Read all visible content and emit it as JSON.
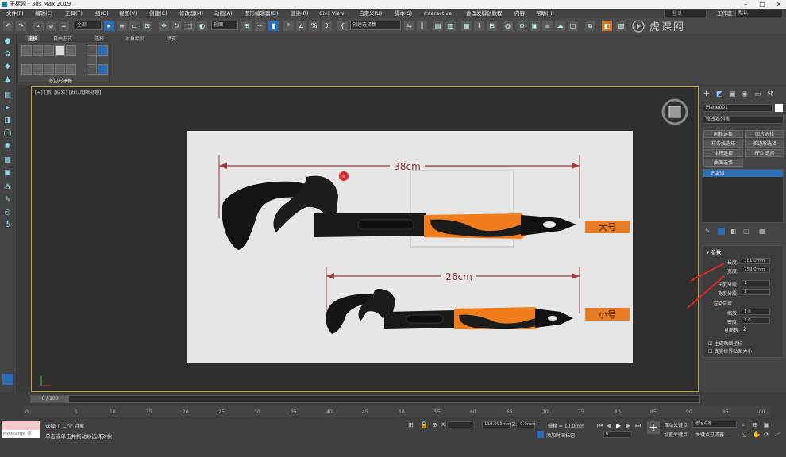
{
  "window": {
    "title": "无标题 - 3ds Max 2019"
  },
  "menu": [
    "文件(F)",
    "编辑(E)",
    "工具(T)",
    "组(G)",
    "视图(V)",
    "创建(C)",
    "修改器(M)",
    "动画(A)",
    "图形编辑器(D)",
    "渲染(R)",
    "Civil View",
    "自定义(U)",
    "脚本(S)",
    "Interactive",
    "香理发脚创教程",
    "内容",
    "帮助(H)"
  ],
  "search": {
    "placeholder": "登录"
  },
  "workspace_label": "工作区",
  "workspace_value": "默认",
  "toolbar": {
    "selection_filter": "全部",
    "ref_coord": "视图",
    "named_selection": "创建选择集"
  },
  "ribbon": {
    "tabs": [
      "建模",
      "自由形式",
      "选择",
      "对象绘制",
      "填充"
    ],
    "group_label": "多边形建模"
  },
  "viewport": {
    "label": "[+] [顶] [标准] [默认明暗处理]"
  },
  "image": {
    "large_dim": "38cm",
    "small_dim": "26cm",
    "large_tag": "大号",
    "small_tag": "小号"
  },
  "command_panel": {
    "object_name": "Plane001",
    "modifier_list": "修改器列表",
    "buttons": [
      "网格选择",
      "面片选择",
      "样条线选择",
      "多边形选择",
      "体积选择",
      "FFD 选择",
      "曲面选择"
    ],
    "stack_item": "Plane",
    "rollout_title": "参数",
    "length_label": "长度:",
    "length_value": "381.0mm",
    "width_label": "宽度:",
    "width_value": "759.0mm",
    "length_segs_label": "长度分段:",
    "length_segs_value": "1",
    "width_segs_label": "宽度分段:",
    "width_segs_value": "1",
    "render_mult_label": "渲染倍增",
    "scale_label": "缩放:",
    "scale_value": "1.0",
    "density_label": "密度:",
    "density_value": "1.0",
    "total_faces_label": "总面数:",
    "total_faces_value": "2",
    "gen_mapping": "生成贴图坐标",
    "real_world": "真实世界贴图大小"
  },
  "timeline": {
    "frame_counter": "0 / 100",
    "ticks": [
      "0",
      "5",
      "10",
      "15",
      "20",
      "25",
      "30",
      "35",
      "40",
      "45",
      "50",
      "55",
      "60",
      "65",
      "70",
      "75",
      "80",
      "85",
      "90",
      "95",
      "100"
    ]
  },
  "status": {
    "maxscript": "MAXScript 侦",
    "selected": "选择了 1 个 对象",
    "prompt": "单击或单击并拖动以选择对象",
    "x_label": "X:",
    "y_value": "118.093mm",
    "z_label": "Z:",
    "z_value": "0.0mm",
    "grid": "栅格 = 10.0mm",
    "add_time_tag": "添加时间标记",
    "auto_key": "自动关键点",
    "set_key": "设置关键点",
    "selected_obj": "选定对象",
    "key_filters": "关键点过滤器...",
    "frame_value": "0"
  },
  "colors": {
    "accent": "#2d6db5",
    "viewport_border": "#c3a33a",
    "orange": "#f07c1c"
  }
}
